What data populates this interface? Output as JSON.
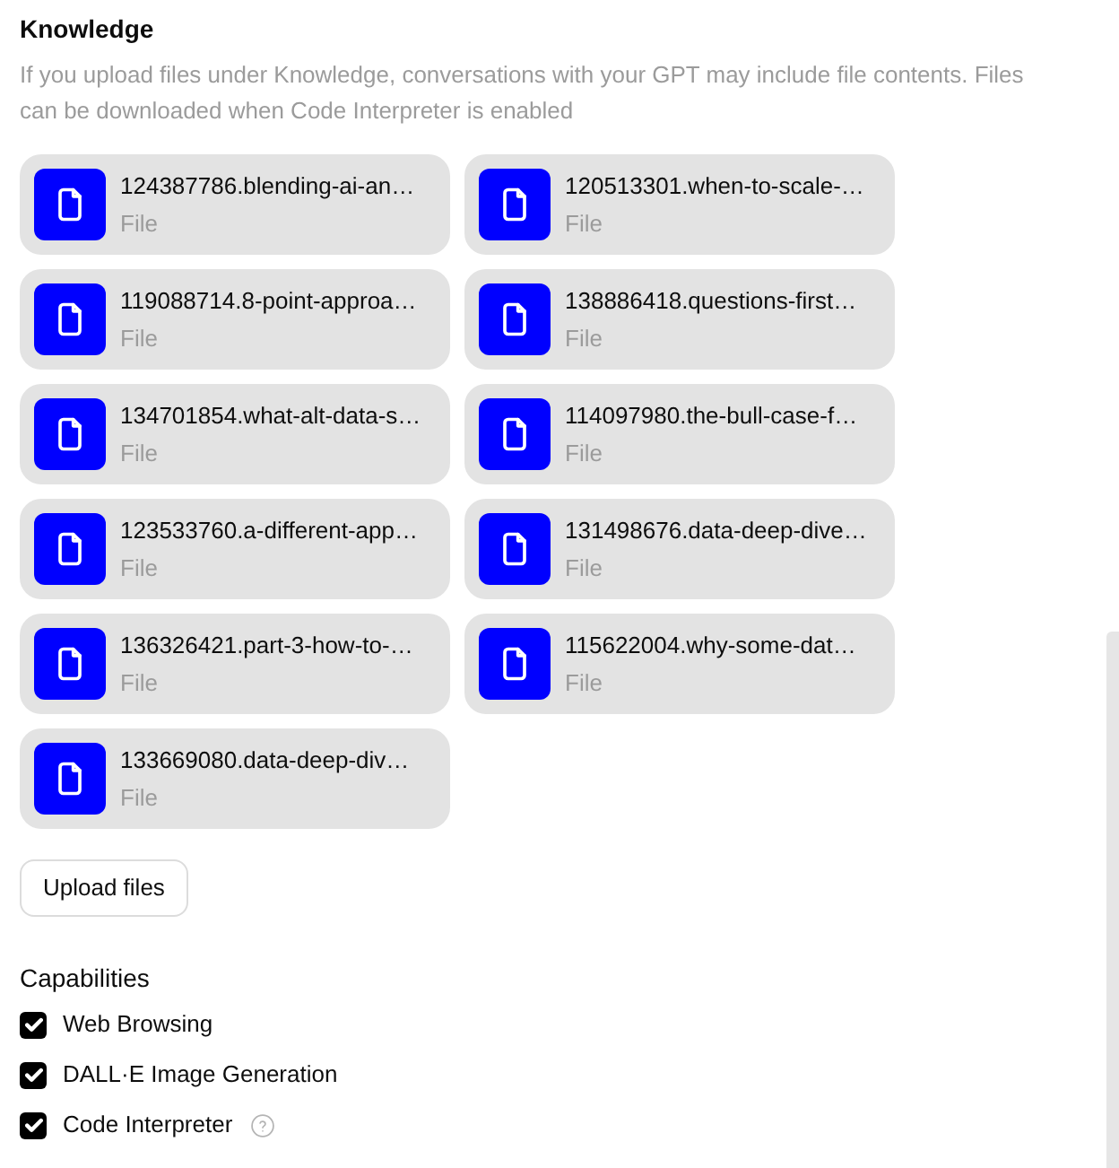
{
  "knowledge": {
    "title": "Knowledge",
    "description": "If you upload files under Knowledge, conversations with your GPT may include file contents. Files can be downloaded when Code Interpreter is enabled",
    "files": [
      {
        "name": "124387786.blending-ai-an…",
        "type": "File"
      },
      {
        "name": "120513301.when-to-scale-…",
        "type": "File"
      },
      {
        "name": "119088714.8-point-approa…",
        "type": "File"
      },
      {
        "name": "138886418.questions-first…",
        "type": "File"
      },
      {
        "name": "134701854.what-alt-data-s…",
        "type": "File"
      },
      {
        "name": "114097980.the-bull-case-f…",
        "type": "File"
      },
      {
        "name": "123533760.a-different-app…",
        "type": "File"
      },
      {
        "name": "131498676.data-deep-dive…",
        "type": "File"
      },
      {
        "name": "136326421.part-3-how-to-…",
        "type": "File"
      },
      {
        "name": "115622004.why-some-dat…",
        "type": "File"
      },
      {
        "name": "133669080.data-deep-div…",
        "type": "File"
      }
    ],
    "upload_button": "Upload files"
  },
  "capabilities": {
    "title": "Capabilities",
    "items": [
      {
        "label": "Web Browsing",
        "checked": true,
        "help": false
      },
      {
        "label": "DALL·E Image Generation",
        "checked": true,
        "help": false
      },
      {
        "label": "Code Interpreter",
        "checked": true,
        "help": true
      }
    ]
  }
}
